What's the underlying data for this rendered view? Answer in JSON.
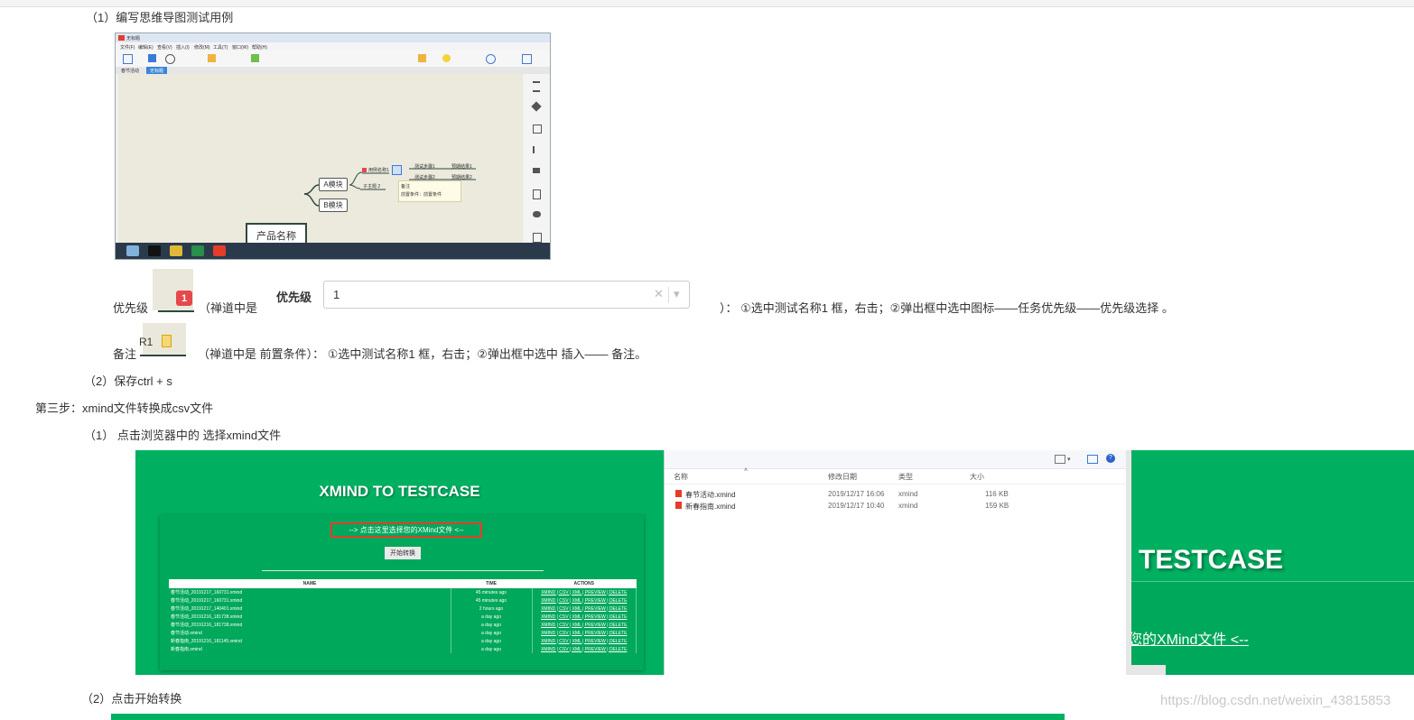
{
  "step1_heading": "（1）编写思维导图测试用例",
  "xmind_app": {
    "title": "无标题",
    "menus": [
      "文件(F)",
      "编辑(E)",
      "查看(V)",
      "插入(I)",
      "修改(M)",
      "工具(T)",
      "窗口(W)",
      "帮助(H)"
    ],
    "tabs": [
      "春节活动",
      "无标题"
    ],
    "root": "产品名称",
    "module_a": "A模块",
    "module_b": "B模块",
    "case1": "用例名称1",
    "case2": "子主题 2",
    "step1": "测试步骤1",
    "step2": "测试步骤2",
    "expect1": "预期结果1",
    "expect2": "预期结果2",
    "note_title": "备注",
    "note_body": "前置条件：前置条件"
  },
  "priority_line": {
    "label": "优先级",
    "badge": "1",
    "paren_open": "（禅道中是",
    "field_label": "优先级",
    "select_value": "1",
    "clear_icon": "✕",
    "arrow_icon": "▾",
    "desc": "）：  ①选中测试名称1 框，右击；②弹出框中选中图标——任务优先级——优先级选择 。"
  },
  "note_line": {
    "label": "备注",
    "badge_text": "R1",
    "desc": "（禅道中是  前置条件）：   ①选中测试名称1 框，右击；②弹出框中选中  插入—— 备注。"
  },
  "save_step": "（2）保存ctrl  +  s",
  "step3_heading": "第三步：xmind文件转换成csv文件",
  "step3_sub1": "（1）   点击浏览器中的    选择xmind文件",
  "testcase_app": {
    "title": "XMIND TO TESTCASE",
    "choose_label": "--> 点击这里选择您的XMind文件 <--",
    "start_button": "开始转换",
    "columns": [
      "NAME",
      "TIME",
      "ACTIONS"
    ],
    "rows": [
      {
        "name": "春节活动_20191217_160731.xmind",
        "time": "45 minutes ago"
      },
      {
        "name": "春节活动_20191217_160731.xmind",
        "time": "45 minutes ago"
      },
      {
        "name": "春节活动_20191217_140401.xmind",
        "time": "2 hours ago"
      },
      {
        "name": "春节活动_20191216_181738.xmind",
        "time": "a day ago"
      },
      {
        "name": "春节活动_20191216_181738.xmind",
        "time": "a day ago"
      },
      {
        "name": "春节活动.xmind",
        "time": "a day ago"
      },
      {
        "name": "新春指南_20191216_181145.xmind",
        "time": "a day ago"
      },
      {
        "name": "新春指南.xmind",
        "time": "a day ago"
      }
    ],
    "actions": "XMIND | CSV | XML | PREVIEW | DELETE"
  },
  "explorer": {
    "columns": [
      "名称",
      "修改日期",
      "类型",
      "大小"
    ],
    "files": [
      {
        "name": "春节活动.xmind",
        "date": "2019/12/17 16:06",
        "type": "xmind",
        "size": "116 KB"
      },
      {
        "name": "新春指南.xmind",
        "date": "2019/12/17 10:40",
        "type": "xmind",
        "size": "159 KB"
      }
    ]
  },
  "zoom_title": "TESTCASE",
  "zoom_link": "您的XMind文件 <--",
  "step3_sub2": "（2）点击开始转换",
  "watermark": "https://blog.csdn.net/weixin_43815853",
  "colors": {
    "green": "#00b061",
    "badge_red": "#e5484d"
  }
}
